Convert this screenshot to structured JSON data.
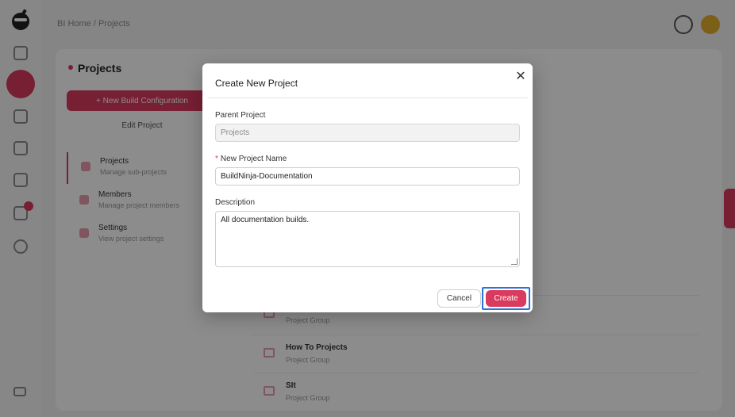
{
  "background": {
    "breadcrumb": "BI Home / Projects",
    "sidebar_title": "Projects",
    "new_build_button": "+ New Build Configuration",
    "edit_project": "Edit Project",
    "nav_items": [
      {
        "title": "Projects",
        "subtitle": "Manage sub-projects"
      },
      {
        "title": "Members",
        "subtitle": "Manage project members"
      },
      {
        "title": "Settings",
        "subtitle": "View project settings"
      }
    ],
    "rows": [
      {
        "title": "",
        "subtitle": "Project Group"
      },
      {
        "title": "How To Projects",
        "subtitle": "Project Group"
      },
      {
        "title": "SIt",
        "subtitle": "Project Group"
      }
    ]
  },
  "modal": {
    "title": "Create New Project",
    "close_icon": "close-icon",
    "parent_label": "Parent Project",
    "parent_value": "Projects",
    "name_label": "New Project Name",
    "name_required_mark": "*",
    "name_value": "BuildNinja-Documentation",
    "description_label": "Description",
    "description_value": "All documentation builds.",
    "cancel_label": "Cancel",
    "create_label": "Create"
  },
  "colors": {
    "accent": "#d93a5e",
    "focus_ring": "#2a73d9"
  }
}
